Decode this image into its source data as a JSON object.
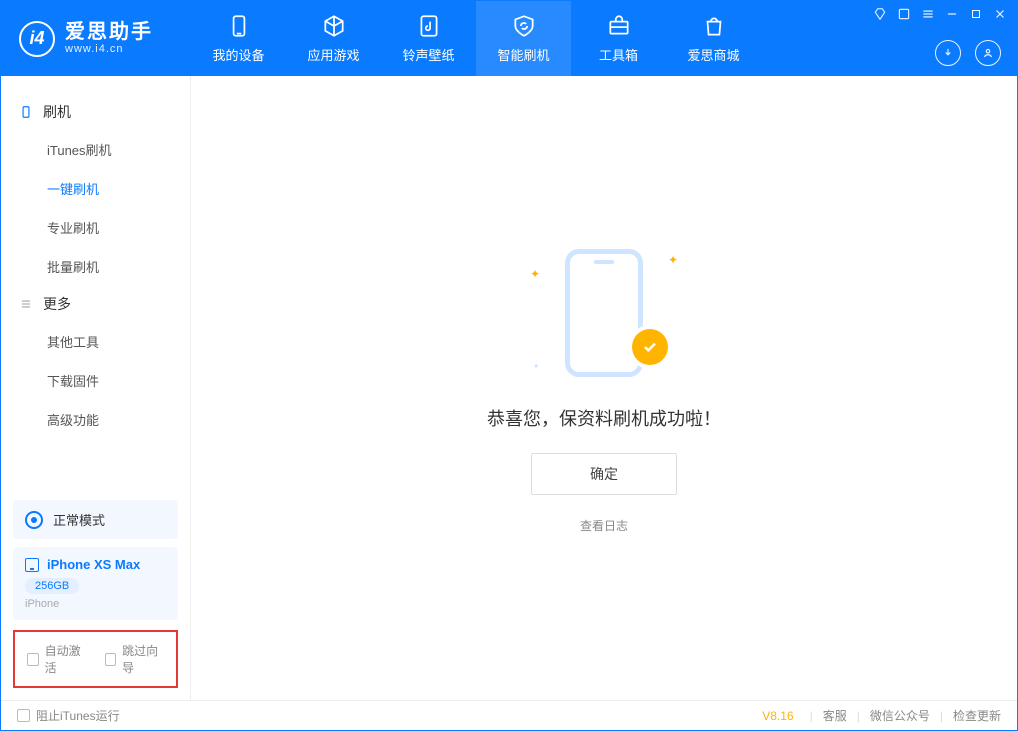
{
  "brand": {
    "cn": "爱思助手",
    "en": "www.i4.cn",
    "logo_letter": "i4"
  },
  "tabs": [
    {
      "label": "我的设备"
    },
    {
      "label": "应用游戏"
    },
    {
      "label": "铃声壁纸"
    },
    {
      "label": "智能刷机"
    },
    {
      "label": "工具箱"
    },
    {
      "label": "爱思商城"
    }
  ],
  "sidebar": {
    "group1_title": "刷机",
    "group1_items": [
      "iTunes刷机",
      "一键刷机",
      "专业刷机",
      "批量刷机"
    ],
    "group2_title": "更多",
    "group2_items": [
      "其他工具",
      "下载固件",
      "高级功能"
    ]
  },
  "mode": {
    "label": "正常模式"
  },
  "device": {
    "name": "iPhone XS Max",
    "storage": "256GB",
    "type": "iPhone"
  },
  "options": {
    "auto_activate": "自动激活",
    "skip_guide": "跳过向导"
  },
  "main": {
    "message": "恭喜您，保资料刷机成功啦！",
    "ok": "确定",
    "view_log": "查看日志"
  },
  "footer": {
    "block_itunes": "阻止iTunes运行",
    "version": "V8.16",
    "support": "客服",
    "wechat": "微信公众号",
    "check_update": "检查更新"
  }
}
